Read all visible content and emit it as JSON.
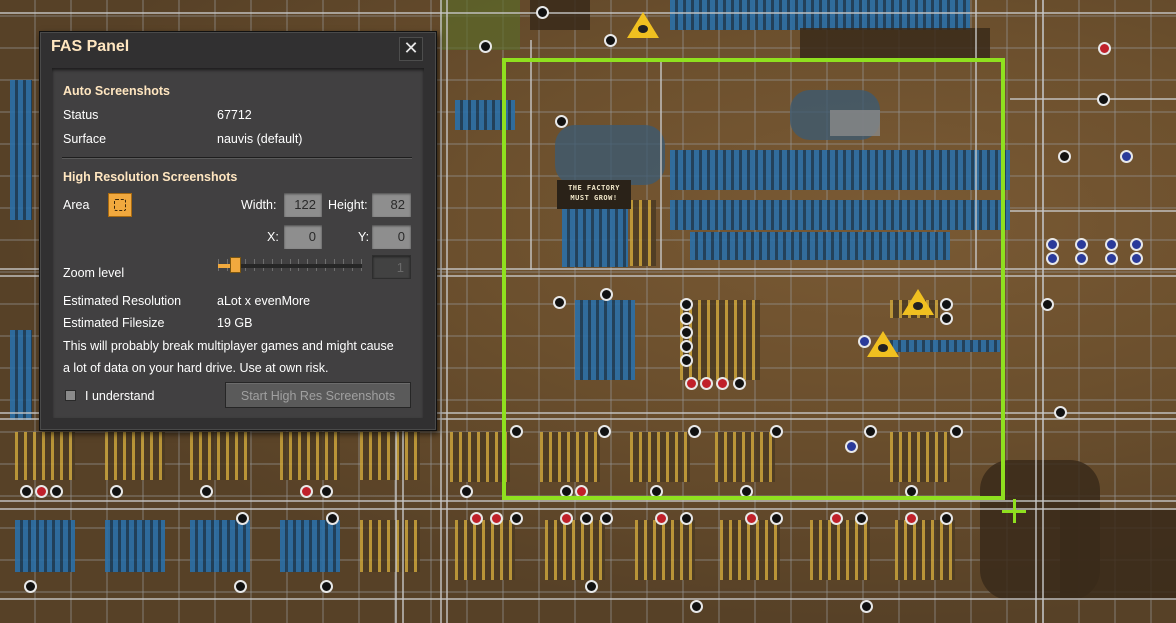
{
  "panel": {
    "title": "FAS Panel",
    "close_glyph": "✕",
    "auto": {
      "header": "Auto Screenshots",
      "status_label": "Status",
      "status_value": "67712",
      "surface_label": "Surface",
      "surface_value": "nauvis (default)"
    },
    "high_res": {
      "header": "High Resolution Screenshots",
      "area_label": "Area",
      "area_icon": "dashed-selection-icon",
      "width_label": "Width:",
      "width_value": "122",
      "height_label": "Height:",
      "height_value": "82",
      "x_label": "X:",
      "x_value": "0",
      "y_label": "Y:",
      "y_value": "0",
      "zoom_label": "Zoom level",
      "zoom_value": "1",
      "zoom_fraction": 0.12,
      "resolution_label": "Estimated Resolution",
      "resolution_value": "aLot x evenMore",
      "filesize_label": "Estimated Filesize",
      "filesize_value": "19 GB",
      "warning_line1": "This will probably break multiplayer games and might cause",
      "warning_line2": "a lot of data on your hard drive. Use at own risk.",
      "understand_label": "I understand",
      "understand_checked": false,
      "start_button": "Start High Res Screenshots"
    }
  },
  "world": {
    "sign_line1": "THE FACTORY",
    "sign_line2": "MUST GROW!",
    "selection_color": "#8fe01f",
    "warning_icon": "warning-triangle-icon"
  },
  "colors": {
    "panel_bg": "#313031",
    "accent_orange": "#f1a93e",
    "header_text": "#ffe6c0"
  }
}
